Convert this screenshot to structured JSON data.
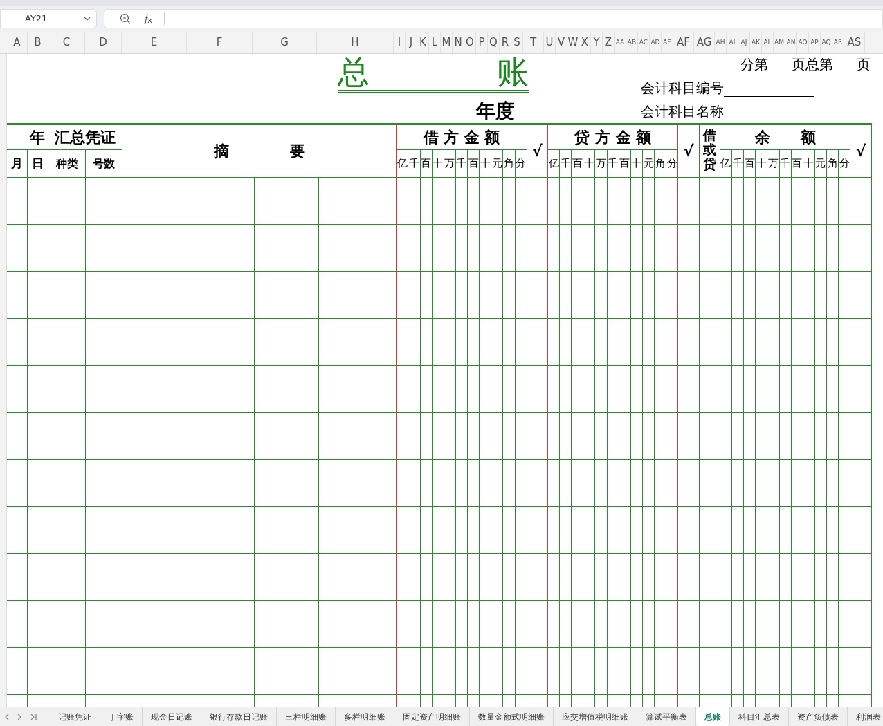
{
  "name_box": {
    "value": "AY21"
  },
  "column_headers": [
    "A",
    "B",
    "C",
    "D",
    "E",
    "F",
    "G",
    "H",
    "I",
    "J",
    "K",
    "L",
    "M",
    "N",
    "O",
    "P",
    "Q",
    "R",
    "S",
    "T",
    "U",
    "V",
    "W",
    "X",
    "Y",
    "Z",
    "AA",
    "AB",
    "AC",
    "AD",
    "AE",
    "AF",
    "AG",
    "AH",
    "AI",
    "AJ",
    "AK",
    "AL",
    "AM",
    "AN",
    "AO",
    "AP",
    "AQ",
    "AR",
    "AS"
  ],
  "ledger": {
    "title": "总　　　　账",
    "year_label": "年度",
    "page_info": [
      "分第",
      "页总第",
      "页"
    ],
    "fields": [
      {
        "label": "会计科目编号"
      },
      {
        "label": "会计科目名称"
      }
    ],
    "header": {
      "year": "年",
      "voucher": "汇总凭证",
      "month": "月",
      "day": "日",
      "kind": "种类",
      "number": "号数",
      "summary": "摘　　　　要",
      "debit": "借 方 金 额",
      "debit_check": "√",
      "credit": "贷 方 金 额",
      "credit_check": "√",
      "direction": "借或贷",
      "balance": "余　　额",
      "balance_check": "√",
      "debit_digits": [
        "亿",
        "千",
        "百",
        "十",
        "万",
        "千",
        "百",
        "十",
        "元",
        "角",
        "分"
      ],
      "credit_digits": [
        "亿",
        "千",
        "百",
        "十",
        "万",
        "千",
        "百",
        "十",
        "元",
        "角",
        "分"
      ],
      "balance_digits": [
        "亿",
        "千",
        "百",
        "十",
        "万",
        "千",
        "百",
        "十",
        "元",
        "角",
        "分"
      ]
    }
  },
  "sheet_tabs": [
    {
      "label": "记账凭证",
      "selected": false
    },
    {
      "label": "丁字账",
      "selected": false
    },
    {
      "label": "现金日记账",
      "selected": false
    },
    {
      "label": "银行存款日记账",
      "selected": false
    },
    {
      "label": "三栏明细账",
      "selected": false
    },
    {
      "label": "多栏明细账",
      "selected": false
    },
    {
      "label": "固定资产明细账",
      "selected": false
    },
    {
      "label": "数量金额式明细账",
      "selected": false
    },
    {
      "label": "应交增值税明细账",
      "selected": false
    },
    {
      "label": "算试平衡表",
      "selected": false
    },
    {
      "label": "总账",
      "selected": true
    },
    {
      "label": "科目汇总表",
      "selected": false
    },
    {
      "label": "资产负债表",
      "selected": false
    },
    {
      "label": "利润表",
      "selected": false
    }
  ]
}
